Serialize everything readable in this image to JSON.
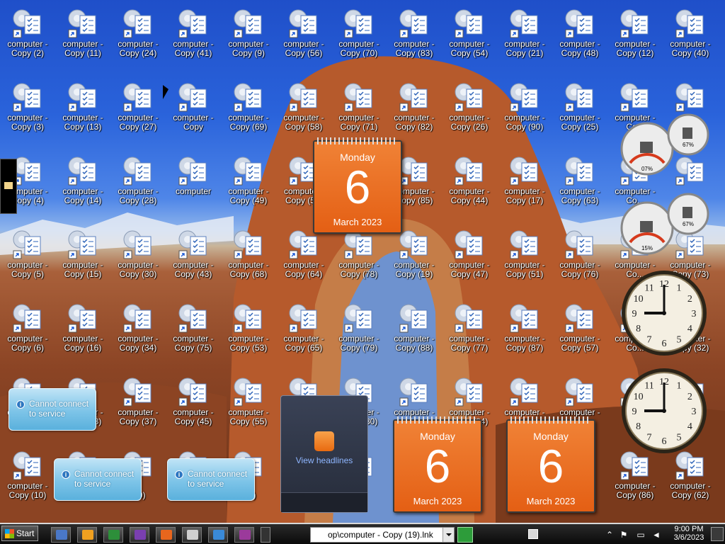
{
  "desktop": {
    "icons": [
      {
        "label": "computer -\nCopy (2)"
      },
      {
        "label": "computer -\nCopy (11)"
      },
      {
        "label": "computer -\nCopy (24)"
      },
      {
        "label": "computer -\nCopy (41)"
      },
      {
        "label": "computer -\nCopy (9)"
      },
      {
        "label": "computer -\nCopy (56)"
      },
      {
        "label": "computer -\nCopy (70)"
      },
      {
        "label": "computer -\nCopy (83)"
      },
      {
        "label": "computer -\nCopy (54)"
      },
      {
        "label": "computer -\nCopy (21)"
      },
      {
        "label": "computer -\nCopy (48)"
      },
      {
        "label": "computer -\nCopy (12)"
      },
      {
        "label": "computer -\nCopy (40)"
      },
      {
        "label": "computer -\nCopy (3)"
      },
      {
        "label": "computer -\nCopy (13)"
      },
      {
        "label": "computer -\nCopy (27)"
      },
      {
        "label": "computer -\nCopy"
      },
      {
        "label": "computer -\nCopy (69)"
      },
      {
        "label": "computer -\nCopy (58)"
      },
      {
        "label": "computer -\nCopy (71)"
      },
      {
        "label": "computer -\nCopy (82)"
      },
      {
        "label": "computer -\nCopy (26)"
      },
      {
        "label": "computer -\nCopy (90)"
      },
      {
        "label": "computer -\nCopy (25)"
      },
      {
        "label": "computer -\nCo..."
      },
      {
        "label": ""
      },
      {
        "label": "computer -\nCopy (4)"
      },
      {
        "label": "computer -\nCopy (14)"
      },
      {
        "label": "computer -\nCopy (28)"
      },
      {
        "label": "computer"
      },
      {
        "label": "computer -\nCopy (49)"
      },
      {
        "label": "compute...\nCopy (5..."
      },
      {
        "label": ""
      },
      {
        "label": "computer -\nCopy (85)"
      },
      {
        "label": "computer -\nCopy (44)"
      },
      {
        "label": "computer -\nCopy (17)"
      },
      {
        "label": "computer -\nCopy (63)"
      },
      {
        "label": "computer -\nCo..."
      },
      {
        "label": ""
      },
      {
        "label": "computer -\nCopy (5)"
      },
      {
        "label": "computer -\nCopy (15)"
      },
      {
        "label": "computer -\nCopy (30)"
      },
      {
        "label": "computer -\nCopy (43)"
      },
      {
        "label": "computer -\nCopy (68)"
      },
      {
        "label": "computer -\nCopy (64)"
      },
      {
        "label": "computer -\nCopy (78)"
      },
      {
        "label": "computer -\nCopy (19)"
      },
      {
        "label": "computer -\nCopy (47)"
      },
      {
        "label": "computer -\nCopy (51)"
      },
      {
        "label": "computer -\nCopy (76)"
      },
      {
        "label": "computer -\nCo..."
      },
      {
        "label": "computer -\nCopy (73)"
      },
      {
        "label": "computer -\nCopy (6)"
      },
      {
        "label": "computer -\nCopy (16)"
      },
      {
        "label": "computer -\nCopy (34)"
      },
      {
        "label": "computer -\nCopy (75)"
      },
      {
        "label": "computer -\nCopy (53)"
      },
      {
        "label": "computer -\nCopy (65)"
      },
      {
        "label": "computer -\nCopy (79)"
      },
      {
        "label": "computer -\nCopy (88)"
      },
      {
        "label": "computer -\nCopy (77)"
      },
      {
        "label": "computer -\nCopy (87)"
      },
      {
        "label": "computer -\nCopy (57)"
      },
      {
        "label": "computer -\nCo..."
      },
      {
        "label": "computer -\nCopy (32)"
      },
      {
        "label": "computer -\nCopy (7)"
      },
      {
        "label": "computer -\nCopy (18)"
      },
      {
        "label": "computer -\nCopy (37)"
      },
      {
        "label": "computer -\nCopy (45)"
      },
      {
        "label": "computer -\nCopy (55)"
      },
      {
        "label": ""
      },
      {
        "label": "computer -\nCopy (80)"
      },
      {
        "label": "computer -\n..."
      },
      {
        "label": "computer -\nCopy (84)"
      },
      {
        "label": "computer -\n..."
      },
      {
        "label": "computer -\n..."
      },
      {
        "label": ""
      },
      {
        "label": ""
      },
      {
        "label": "computer -\nCopy (10)"
      },
      {
        "label": ""
      },
      {
        "label": "...\n(39)"
      },
      {
        "label": ""
      },
      {
        "label": "...\n(42)"
      },
      {
        "label": ""
      },
      {
        "label": "...\n(81)"
      },
      {
        "label": "...\n(2)"
      },
      {
        "label": ""
      },
      {
        "label": ""
      },
      {
        "label": ""
      },
      {
        "label": "computer -\nCopy (86)"
      },
      {
        "label": "computer -\nCopy (62)"
      }
    ]
  },
  "gadgets": {
    "calendars": [
      {
        "day": "Monday",
        "date": "6",
        "month": "March 2023"
      },
      {
        "day": "Monday",
        "date": "6",
        "month": "March 2023"
      },
      {
        "day": "Monday",
        "date": "6",
        "month": "March 2023"
      }
    ],
    "notices": [
      {
        "text": "Cannot connect to service"
      },
      {
        "text": "Cannot connect to service"
      },
      {
        "text": "Cannot connect to service"
      }
    ],
    "feed": {
      "label": "View headlines"
    },
    "meters": [
      {
        "cpu": "07%",
        "mem": "67%"
      },
      {
        "cpu": "15%",
        "mem": "67%"
      }
    ],
    "clocks": [
      {
        "hour": 9,
        "minute": 0
      },
      {
        "hour": 9,
        "minute": 0
      }
    ]
  },
  "taskbar": {
    "start_label": "Start",
    "address_value": "op\\computer - Copy (19).lnk",
    "time": "9:00 PM",
    "date": "3/6/2023",
    "quicklaunch": [
      "show-desktop-icon",
      "media-player-icon",
      "task-manager-icon",
      "people-icon",
      "firefox-icon",
      "calculator-icon",
      "window-icon",
      "app-icon"
    ]
  },
  "colors": {
    "calendar_orange": "#e8661d",
    "taskbar": "#111111"
  }
}
